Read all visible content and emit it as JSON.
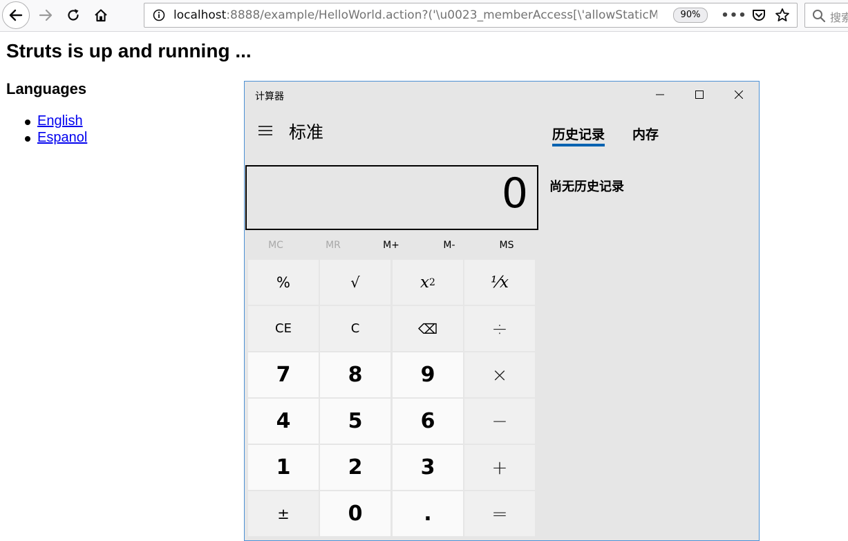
{
  "browser": {
    "url_host": "localhost",
    "url_rest": ":8888/example/HelloWorld.action?('\\u0023_memberAccess[\\'allowStaticM",
    "zoom": "90%",
    "search_placeholder": "搜索"
  },
  "page": {
    "title": "Struts is up and running ...",
    "section_title": "Languages",
    "languages": [
      "English",
      "Espanol"
    ]
  },
  "calculator": {
    "window_title": "计算器",
    "mode": "标准",
    "tabs": [
      "历史记录",
      "内存"
    ],
    "display_value": "0",
    "history_empty": "尚无历史记录",
    "memory_buttons": [
      "MC",
      "MR",
      "M+",
      "M-",
      "MS"
    ],
    "keys": {
      "percent": "%",
      "sqrt": "√",
      "square_base": "x",
      "square_exp": "2",
      "reciprocal": "⅟x",
      "ce": "CE",
      "c": "C",
      "backspace": "⌫",
      "divide": "÷",
      "seven": "7",
      "eight": "8",
      "nine": "9",
      "multiply": "×",
      "four": "4",
      "five": "5",
      "six": "6",
      "minus": "−",
      "one": "1",
      "two": "2",
      "three": "3",
      "plus": "+",
      "negate": "±",
      "zero": "0",
      "decimal": ".",
      "equals": "="
    }
  },
  "colors": {
    "accent": "#0063b1",
    "window_border": "#4a8fd4",
    "link": "#0000ee"
  },
  "icons": [
    "back-arrow-icon",
    "forward-arrow-icon",
    "reload-icon",
    "home-icon",
    "info-icon",
    "more-icon",
    "pocket-icon",
    "star-icon",
    "search-icon",
    "minimize-icon",
    "maximize-icon",
    "close-icon",
    "hamburger-icon"
  ]
}
